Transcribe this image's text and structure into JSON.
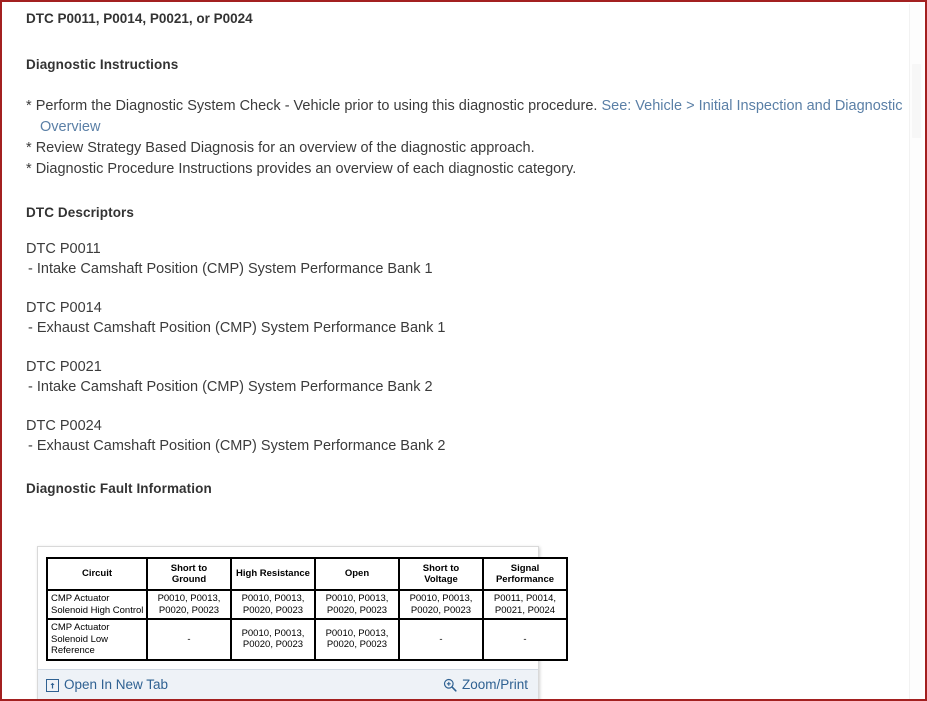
{
  "document": {
    "title": "DTC P0011, P0014, P0021, or P0024",
    "sections": {
      "instructions_heading": "Diagnostic Instructions",
      "descriptors_heading": "DTC Descriptors",
      "fault_info_heading": "Diagnostic Fault Information"
    }
  },
  "instructions": {
    "bullet_marker": "*",
    "items": [
      {
        "text_before": "Perform the Diagnostic System Check - Vehicle prior to using this diagnostic procedure. ",
        "link_text": "See: Vehicle > Initial Inspection and Diagnostic Overview",
        "text_after": ""
      },
      {
        "text_before": "Review Strategy Based Diagnosis for an overview of the diagnostic approach.",
        "link_text": "",
        "text_after": ""
      },
      {
        "text_before": "Diagnostic Procedure Instructions provides an overview of each diagnostic category.",
        "link_text": "",
        "text_after": ""
      }
    ]
  },
  "descriptors": {
    "dash_marker": "-",
    "items": [
      {
        "code": "DTC P0011",
        "description": "Intake Camshaft Position (CMP) System Performance Bank 1"
      },
      {
        "code": "DTC P0014",
        "description": "Exhaust Camshaft Position (CMP) System Performance Bank 1"
      },
      {
        "code": "DTC P0021",
        "description": "Intake Camshaft Position (CMP) System Performance Bank 2"
      },
      {
        "code": "DTC P0024",
        "description": "Exhaust Camshaft Position (CMP) System Performance Bank 2"
      }
    ]
  },
  "fault_table": {
    "headers": [
      "Circuit",
      "Short to Ground",
      "High Resistance",
      "Open",
      "Short to Voltage",
      "Signal Performance"
    ],
    "headers_lines": [
      [
        "Circuit"
      ],
      [
        "Short to",
        "Ground"
      ],
      [
        "High Resistance"
      ],
      [
        "Open"
      ],
      [
        "Short to",
        "Voltage"
      ],
      [
        "Signal",
        "Performance"
      ]
    ],
    "rows": [
      {
        "circuit": "CMP Actuator Solenoid High Control",
        "cells": [
          [
            "P0010, P0013,",
            "P0020, P0023"
          ],
          [
            "P0010, P0013,",
            "P0020, P0023"
          ],
          [
            "P0010, P0013,",
            "P0020, P0023"
          ],
          [
            "P0010, P0013,",
            "P0020, P0023"
          ],
          [
            "P0011, P0014,",
            "P0021, P0024"
          ]
        ]
      },
      {
        "circuit": "CMP Actuator Solenoid Low Reference",
        "cells": [
          [
            "-"
          ],
          [
            "P0010, P0013,",
            "P0020, P0023"
          ],
          [
            "P0010, P0013,",
            "P0020, P0023"
          ],
          [
            "-"
          ],
          [
            "-"
          ]
        ]
      }
    ]
  },
  "widget_footer": {
    "open_new_tab_label": "Open In New Tab",
    "open_new_tab_icon": "open-in-new-tab-icon",
    "zoom_print_label": "Zoom/Print",
    "zoom_print_icon": "magnifier-plus-icon"
  },
  "colors": {
    "frame_border": "#a32020",
    "link": "#5a7fa6",
    "action_link": "#2f6192",
    "body_text": "#3b3b3b",
    "heading_text": "#333333",
    "footer_bar": "#eef2f7",
    "table_border": "#000000"
  }
}
